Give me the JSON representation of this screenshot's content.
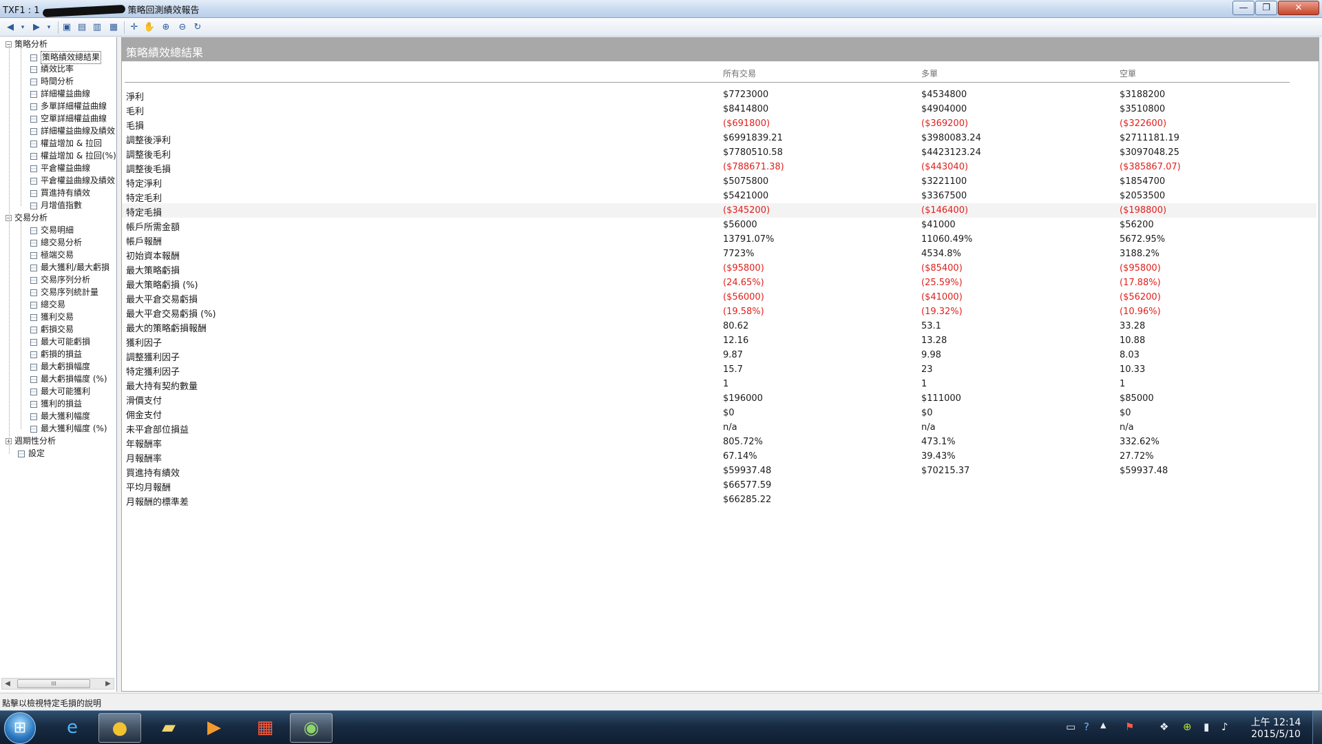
{
  "window": {
    "title_prefix": "TXF1 : 1",
    "title_suffix": "策略回測績效報告",
    "min_glyph": "—",
    "max_glyph": "❐",
    "close_glyph": "✕"
  },
  "toolbar": {
    "icons": [
      "back-icon",
      "dropdown-icon",
      "forward-icon",
      "dropdown-icon",
      "save-icon",
      "preview-icon",
      "print-icon",
      "layout-icon",
      "pointer-icon",
      "hand-icon",
      "zoom-in-icon",
      "zoom-out-icon",
      "refresh-icon"
    ]
  },
  "tree": {
    "groups": [
      {
        "label": "策略分析",
        "expanded": true,
        "items": [
          "策略績效總結果",
          "績效比率",
          "時間分析",
          "詳細權益曲線",
          "多單詳細權益曲線",
          "空單詳細權益曲線",
          "詳細權益曲線及績效",
          "權益增加 & 拉回",
          "權益增加 & 拉回(%)",
          "平倉權益曲線",
          "平倉權益曲線及績效",
          "買進持有績效",
          "月增值指數"
        ]
      },
      {
        "label": "交易分析",
        "expanded": true,
        "items": [
          "交易明細",
          "總交易分析",
          "極端交易",
          "最大獲利/最大虧損",
          "交易序列分析",
          "交易序列統計量",
          "總交易",
          "獲利交易",
          "虧損交易",
          "最大可能虧損",
          "虧損的損益",
          "最大虧損幅度",
          "最大虧損幅度 (%)",
          "最大可能獲利",
          "獲利的損益",
          "最大獲利幅度",
          "最大獲利幅度 (%)"
        ]
      },
      {
        "label": "週期性分析",
        "expanded": false,
        "items": []
      }
    ],
    "settings_label": "設定",
    "selected": "策略績效總結果",
    "scroll_left": "◀",
    "scroll_right": "▶",
    "scroll_thumb": "III"
  },
  "report": {
    "title": "策略績效總結果",
    "columns": [
      "所有交易",
      "多單",
      "空單"
    ],
    "highlight_row": 8,
    "rows": [
      {
        "label": "淨利",
        "v": [
          "$7723000",
          "$4534800",
          "$3188200"
        ]
      },
      {
        "label": "毛利",
        "v": [
          "$8414800",
          "$4904000",
          "$3510800"
        ]
      },
      {
        "label": "毛損",
        "v": [
          "($691800)",
          "($369200)",
          "($322600)"
        ],
        "neg": true
      },
      {
        "label": "調整後淨利",
        "v": [
          "$6991839.21",
          "$3980083.24",
          "$2711181.19"
        ]
      },
      {
        "label": "調整後毛利",
        "v": [
          "$7780510.58",
          "$4423123.24",
          "$3097048.25"
        ]
      },
      {
        "label": "調整後毛損",
        "v": [
          "($788671.38)",
          "($443040)",
          "($385867.07)"
        ],
        "neg": true
      },
      {
        "label": "特定淨利",
        "v": [
          "$5075800",
          "$3221100",
          "$1854700"
        ]
      },
      {
        "label": "特定毛利",
        "v": [
          "$5421000",
          "$3367500",
          "$2053500"
        ]
      },
      {
        "label": "特定毛損",
        "v": [
          "($345200)",
          "($146400)",
          "($198800)"
        ],
        "neg": true
      },
      {
        "label": "帳戶所需金額",
        "v": [
          "$56000",
          "$41000",
          "$56200"
        ]
      },
      {
        "label": "帳戶報酬",
        "v": [
          "13791.07%",
          "11060.49%",
          "5672.95%"
        ]
      },
      {
        "label": "初始資本報酬",
        "v": [
          "7723%",
          "4534.8%",
          "3188.2%"
        ]
      },
      {
        "label": "最大策略虧損",
        "v": [
          "($95800)",
          "($85400)",
          "($95800)"
        ],
        "neg": true
      },
      {
        "label": "最大策略虧損 (%)",
        "v": [
          "(24.65%)",
          "(25.59%)",
          "(17.88%)"
        ],
        "neg": true
      },
      {
        "label": "最大平倉交易虧損",
        "v": [
          "($56000)",
          "($41000)",
          "($56200)"
        ],
        "neg": true
      },
      {
        "label": "最大平倉交易虧損 (%)",
        "v": [
          "(19.58%)",
          "(19.32%)",
          "(10.96%)"
        ],
        "neg": true
      },
      {
        "label": "最大的策略虧損報酬",
        "v": [
          "80.62",
          "53.1",
          "33.28"
        ]
      },
      {
        "label": "獲利因子",
        "v": [
          "12.16",
          "13.28",
          "10.88"
        ]
      },
      {
        "label": "調整獲利因子",
        "v": [
          "9.87",
          "9.98",
          "8.03"
        ]
      },
      {
        "label": "特定獲利因子",
        "v": [
          "15.7",
          "23",
          "10.33"
        ]
      },
      {
        "label": "最大持有契約數量",
        "v": [
          "1",
          "1",
          "1"
        ]
      },
      {
        "label": "滑價支付",
        "v": [
          "$196000",
          "$111000",
          "$85000"
        ]
      },
      {
        "label": "佣金支付",
        "v": [
          "$0",
          "$0",
          "$0"
        ]
      },
      {
        "label": "未平倉部位損益",
        "v": [
          "n/a",
          "n/a",
          "n/a"
        ]
      },
      {
        "label": "年報酬率",
        "v": [
          "805.72%",
          "473.1%",
          "332.62%"
        ]
      },
      {
        "label": "月報酬率",
        "v": [
          "67.14%",
          "39.43%",
          "27.72%"
        ]
      },
      {
        "label": "買進持有績效",
        "v": [
          "$59937.48",
          "$70215.37",
          "$59937.48"
        ]
      },
      {
        "label": "平均月報酬",
        "v": [
          "$66577.59",
          "",
          ""
        ]
      },
      {
        "label": "月報酬的標準差",
        "v": [
          "$66285.22",
          "",
          ""
        ]
      }
    ]
  },
  "status": {
    "text": "點擊以檢視特定毛損的說明"
  },
  "taskbar": {
    "apps": [
      "windows-start-icon",
      "internet-explorer-icon",
      "chrome-icon",
      "file-explorer-icon",
      "media-player-icon",
      "app-grid-icon",
      "trading-app-icon"
    ],
    "clock_time": "上午 12:14",
    "clock_date": "2015/5/10"
  },
  "colors": {
    "negative": "#e0201c",
    "header_bar": "#a8a8a8",
    "taskbar": "#182b42"
  }
}
